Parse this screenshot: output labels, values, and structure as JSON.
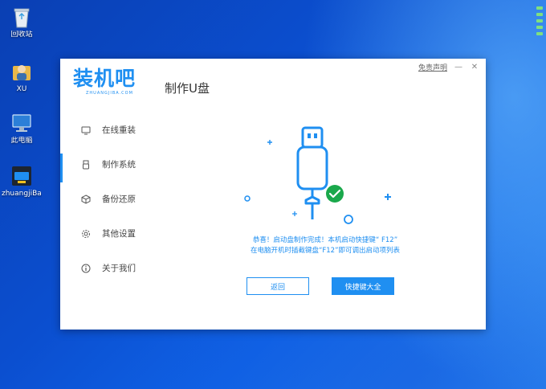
{
  "desktop": {
    "icons": [
      {
        "name": "recycle-bin",
        "label": "回收站"
      },
      {
        "name": "user-folder",
        "label": "XU"
      },
      {
        "name": "this-pc",
        "label": "此电脑"
      },
      {
        "name": "zhuangjiba",
        "label": "zhuangjiBa..."
      }
    ]
  },
  "window": {
    "brand": "装机吧",
    "brand_sub": "ZHUANGJIBA.COM",
    "title": "制作U盘",
    "disclaimer": "免责声明",
    "minimize": "—",
    "close": "✕"
  },
  "sidebar": {
    "items": [
      {
        "label": "在线重装",
        "icon": "monitor-icon"
      },
      {
        "label": "制作系统",
        "icon": "usb-icon"
      },
      {
        "label": "备份还原",
        "icon": "cube-icon"
      },
      {
        "label": "其他设置",
        "icon": "gear-icon"
      },
      {
        "label": "关于我们",
        "icon": "info-icon"
      }
    ],
    "active_index": 1
  },
  "main": {
    "message_line1": "恭喜！启动盘制作完成！本机启动快捷键“ F12”",
    "message_line2": "在电脑开机时插截键盘“F12”即可调出启动项列表",
    "back_button": "返回",
    "hotkeys_button": "快捷键大全"
  },
  "colors": {
    "accent": "#1f8ff1",
    "success": "#1aa84b"
  }
}
